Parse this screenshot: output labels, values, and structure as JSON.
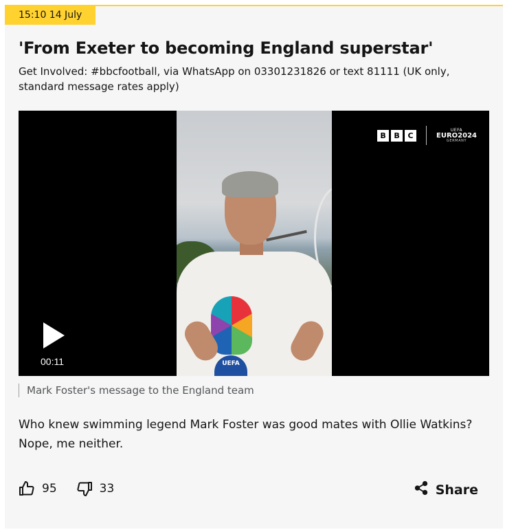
{
  "post": {
    "timestamp": "15:10 14 July",
    "headline": "'From Exeter to becoming England superstar'",
    "subline": "Get Involved: #bbcfootball, via WhatsApp on 03301231826 or text 81111 (UK only, standard message rates apply)",
    "body": "Who knew swimming legend Mark Foster was good mates with Ollie Watkins? Nope, me neither."
  },
  "video": {
    "duration": "00:11",
    "caption": "Mark Foster's message to the England team",
    "brand_letters": [
      "B",
      "B",
      "C"
    ],
    "euro_mark": "UEFA",
    "euro_name": "EURO2024",
    "euro_host": "GERMANY",
    "badge_text": "UEFA"
  },
  "reactions": {
    "like_count": "95",
    "dislike_count": "33"
  },
  "share": {
    "label": "Share"
  },
  "icons": {
    "like": "thumbs-up-icon",
    "dislike": "thumbs-down-icon",
    "share": "share-icon",
    "play": "play-icon"
  },
  "colors": {
    "accent_yellow": "#ffd230",
    "card_background": "#f6f6f6",
    "text": "#141414",
    "caption_text": "#545658"
  }
}
